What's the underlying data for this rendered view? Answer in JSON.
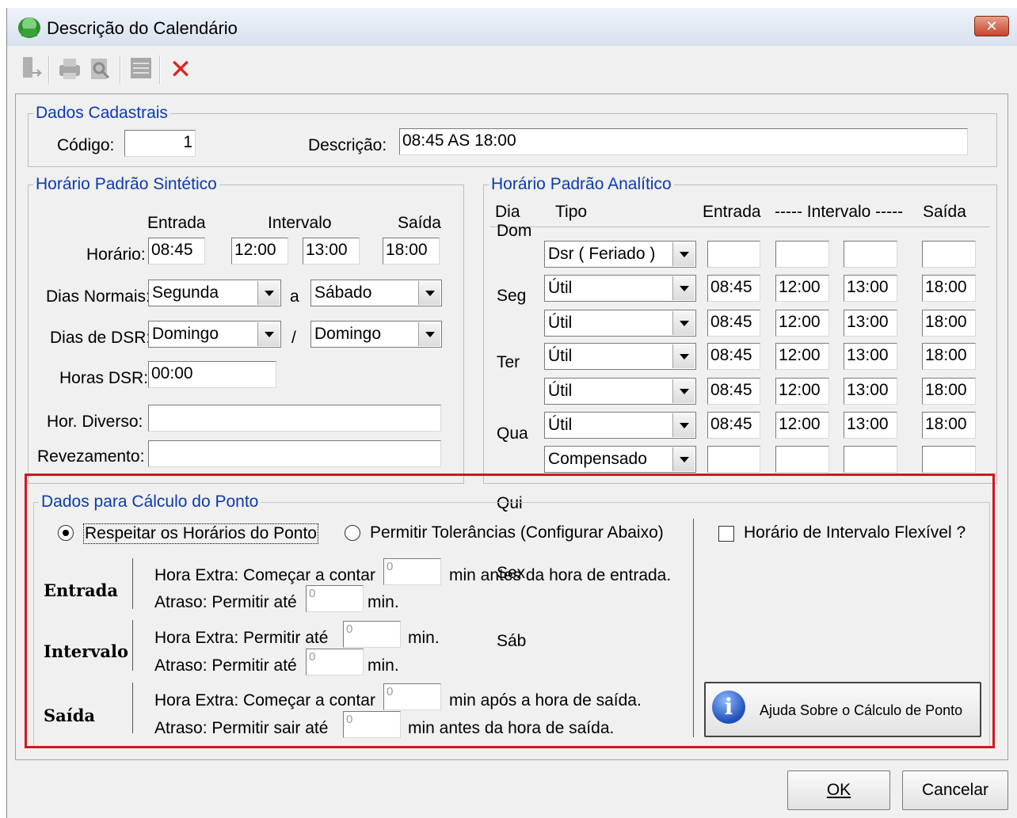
{
  "window": {
    "title": "Descrição do Calendário",
    "close_label": "✕"
  },
  "toolbar": {
    "icons": [
      "exit-icon",
      "print-icon",
      "preview-icon",
      "list-icon",
      "delete-icon"
    ],
    "delete_glyph": "✕"
  },
  "dados_cadastrais": {
    "title": "Dados Cadastrais",
    "codigo_label": "Código:",
    "codigo_value": "1",
    "descricao_label": "Descrição:",
    "descricao_value": "08:45 AS 18:00"
  },
  "sintetico": {
    "title": "Horário Padrão Sintético",
    "col_entrada": "Entrada",
    "col_intervalo": "Intervalo",
    "col_saida": "Saída",
    "horario_label": "Horário:",
    "horario": {
      "entrada": "08:45",
      "intervalo_inicio": "12:00",
      "intervalo_fim": "13:00",
      "saida": "18:00"
    },
    "dias_normais_label": "Dias Normais:",
    "dias_normais_de": "Segunda",
    "dias_normais_sep": "a",
    "dias_normais_ate": "Sábado",
    "dias_dsr_label": "Dias de DSR:",
    "dias_dsr_de": "Domingo",
    "dias_dsr_sep": "/",
    "dias_dsr_ate": "Domingo",
    "horas_dsr_label": "Horas DSR:",
    "horas_dsr_value": "00:00",
    "hor_diverso_label": "Hor. Diverso:",
    "hor_diverso_value": "",
    "revezamento_label": "Revezamento:",
    "revezamento_value": ""
  },
  "analitico": {
    "title": "Horário Padrão Analítico",
    "headers": {
      "dia": "Dia",
      "tipo": "Tipo",
      "entrada": "Entrada",
      "intervalo": "----- Intervalo -----",
      "saida": "Saída"
    },
    "rows": [
      {
        "dia": "Dom",
        "tipo": "Dsr ( Feriado )",
        "entrada": "",
        "int_ini": "",
        "int_fim": "",
        "saida": ""
      },
      {
        "dia": "Seg",
        "tipo": "Útil",
        "entrada": "08:45",
        "int_ini": "12:00",
        "int_fim": "13:00",
        "saida": "18:00"
      },
      {
        "dia": "Ter",
        "tipo": "Útil",
        "entrada": "08:45",
        "int_ini": "12:00",
        "int_fim": "13:00",
        "saida": "18:00"
      },
      {
        "dia": "Qua",
        "tipo": "Útil",
        "entrada": "08:45",
        "int_ini": "12:00",
        "int_fim": "13:00",
        "saida": "18:00"
      },
      {
        "dia": "Qui",
        "tipo": "Útil",
        "entrada": "08:45",
        "int_ini": "12:00",
        "int_fim": "13:00",
        "saida": "18:00"
      },
      {
        "dia": "Sex",
        "tipo": "Útil",
        "entrada": "08:45",
        "int_ini": "12:00",
        "int_fim": "13:00",
        "saida": "18:00"
      },
      {
        "dia": "Sáb",
        "tipo": "Compensado",
        "entrada": "",
        "int_ini": "",
        "int_fim": "",
        "saida": ""
      }
    ]
  },
  "calculo": {
    "title": "Dados para Cálculo do Ponto",
    "radio_respeitar": "Respeitar os Horários do Ponto",
    "radio_permitir": "Permitir Tolerâncias (Configurar Abaixo)",
    "checkbox_intervalo": "Horário de Intervalo Flexível ?",
    "entrada_label": "Entrada",
    "entrada_he_pre": "Hora Extra: Começar a contar",
    "entrada_he_val": "0",
    "entrada_he_post": "min antes da hora de entrada.",
    "entrada_at_pre": "Atraso: Permitir até",
    "entrada_at_val": "0",
    "entrada_at_post": "min.",
    "intervalo_label": "Intervalo",
    "intervalo_he_pre": "Hora Extra: Permitir até",
    "intervalo_he_val": "0",
    "intervalo_he_post": "min.",
    "intervalo_at_pre": "Atraso: Permitir até",
    "intervalo_at_val": "0",
    "intervalo_at_post": "min.",
    "saida_label": "Saída",
    "saida_he_pre": "Hora Extra: Começar a contar",
    "saida_he_val": "0",
    "saida_he_post": "min após a hora de saída.",
    "saida_at_pre": "Atraso: Permitir sair até",
    "saida_at_val": "0",
    "saida_at_post": "min antes da hora de saída.",
    "help_button": "Ajuda Sobre o Cálculo de Ponto",
    "help_icon_glyph": "i"
  },
  "footer": {
    "ok_label": "OK",
    "cancel_label": "Cancelar"
  },
  "colors": {
    "group_title": "#0b3bb0",
    "highlight": "#d4151e",
    "delete": "#e02020"
  }
}
